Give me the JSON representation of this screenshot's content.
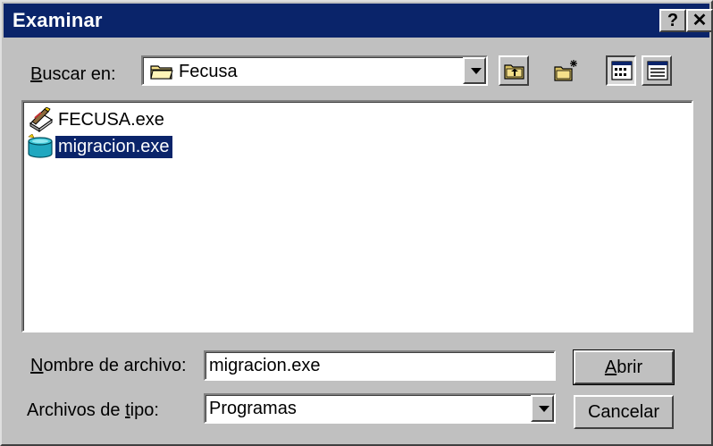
{
  "window": {
    "title": "Examinar",
    "help_glyph": "?",
    "close_glyph": "✕"
  },
  "lookin": {
    "label_underlined": "B",
    "label_rest": "uscar en:",
    "value": "Fecusa"
  },
  "toolbar": {
    "icons": [
      "up-one-level-icon",
      "new-folder-icon",
      "list-view-icon",
      "details-view-icon"
    ]
  },
  "files": [
    {
      "name": "FECUSA.exe",
      "icon": "setup-exe-icon",
      "selected": false
    },
    {
      "name": "migracion.exe",
      "icon": "database-exe-icon",
      "selected": true
    }
  ],
  "filename": {
    "label_underlined": "N",
    "label_rest": "ombre de archivo:",
    "value": "migracion.exe"
  },
  "filetype": {
    "label_before": "Archivos de ",
    "label_underlined": "t",
    "label_rest": "ipo:",
    "value": "Programas"
  },
  "buttons": {
    "open_underlined": "A",
    "open_rest": "brir",
    "cancel": "Cancelar"
  }
}
